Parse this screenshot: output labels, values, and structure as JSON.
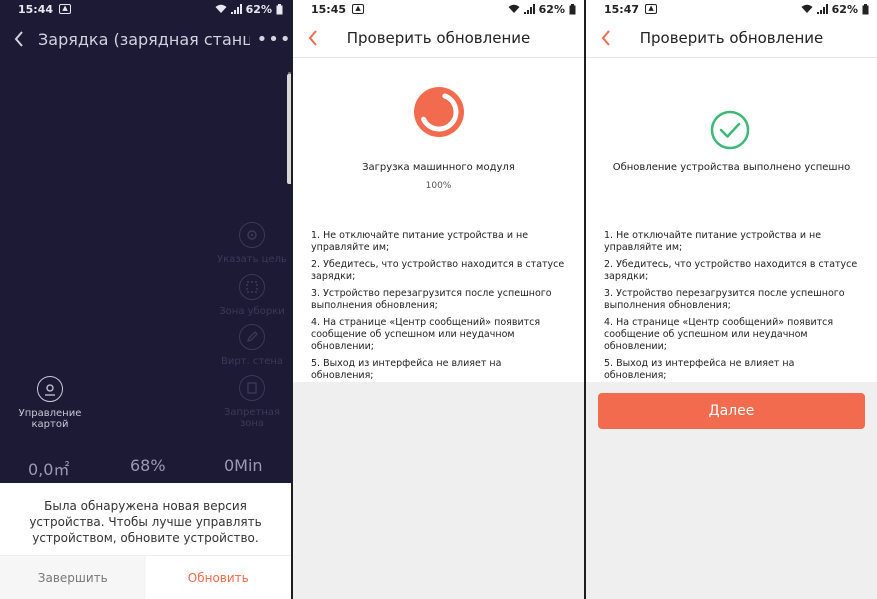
{
  "screen1": {
    "time": "15:44",
    "battery": "62%",
    "title": "Зарядка (зарядная станц...",
    "controls": {
      "set_target": "Указать цель",
      "cleaning_zone": "Зона уборки",
      "virtual_wall": "Вирт. стена",
      "no_go_zone": "Запретная зона",
      "map_management": "Управление картой"
    },
    "stats": {
      "area": "0,0㎡",
      "battery": "68%",
      "time": "0Min"
    },
    "dialog": {
      "message": "Была обнаружена новая версия устройства. Чтобы лучше управлять устройством, обновите устройство.",
      "cancel": "Завершить",
      "confirm": "Обновить"
    }
  },
  "screen2": {
    "time": "15:45",
    "battery": "62%",
    "title": "Проверить обновление",
    "status_label": "Загрузка машинного модуля",
    "progress_text": "100%",
    "progress": 1.0,
    "notes": [
      "1. Не отключайте питание устройства и не управляйте им;",
      "2. Убедитесь, что устройство находится в статусе зарядки;",
      "3. Устройство перезагрузится после успешного выполнения обновления;",
      "4. На странице «Центр сообщений» появится сообщение об успешном или неудачном обновлении;",
      "5. Выход из интерфейса не влияет на обновления;"
    ]
  },
  "screen3": {
    "time": "15:47",
    "battery": "62%",
    "title": "Проверить обновление",
    "status_label": "Обновление устройства выполнено успешно",
    "notes": [
      "1. Не отключайте питание устройства и не управляйте им;",
      "2. Убедитесь, что устройство находится в статусе зарядки;",
      "3. Устройство перезагрузится после успешного выполнения обновления;",
      "4. На странице «Центр сообщений» появится сообщение об успешном или неудачном обновлении;",
      "5. Выход из интерфейса не влияет на обновления;"
    ],
    "next_button": "Далее"
  },
  "colors": {
    "accent": "#f26b4f",
    "success": "#3cb878",
    "dark_bg": "#1c1a35"
  }
}
